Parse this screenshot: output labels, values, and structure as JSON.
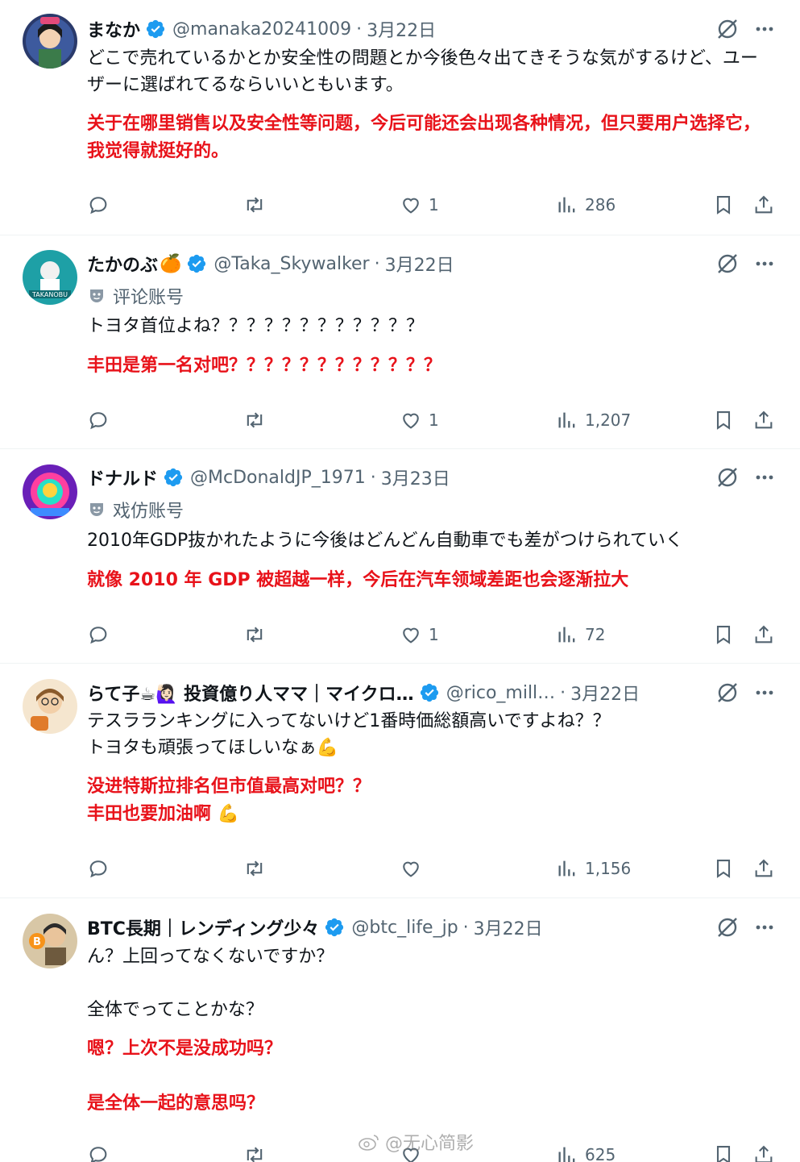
{
  "tweets": [
    {
      "name": "まなか",
      "handle": "@manaka20241009",
      "time": "3月22日",
      "text": "どこで売れているかとか安全性の問題とか今後色々出てきそうな気がするけど、ユーザーに選ばれてるならいいともいます。",
      "translation": "关于在哪里销售以及安全性等问题，今后可能还会出现各种情况，但只要用户选择它，我觉得就挺好的。",
      "likes": "1",
      "views": "286"
    },
    {
      "name": "たかのぶ",
      "name_emoji": "🍊",
      "handle": "@Taka_Skywalker",
      "time": "3月22日",
      "account_label": "评论账号",
      "text": "トヨタ首位よね？？？？？？？？？？？？",
      "translation": "丰田是第一名对吧？？？？？？？？？？？？",
      "likes": "1",
      "views": "1,207"
    },
    {
      "name": "ドナルド",
      "handle": "@McDonaldJP_1971",
      "time": "3月23日",
      "account_label": "戏仿账号",
      "text": "2010年GDP抜かれたように今後はどんどん自動車でも差がつけられていく",
      "translation": "就像 2010 年 GDP 被超越一样，今后在汽车领域差距也会逐渐拉大",
      "likes": "1",
      "views": "72"
    },
    {
      "name": "らて子☕🙋🏻‍♀️ 投資億り人ママ｜マイクロ…",
      "handle": "@rico_mill…",
      "time": "3月22日",
      "text": "テスラランキングに入ってないけど1番時価総額高いですよね？？\nトヨタも頑張ってほしいなぁ💪",
      "translation": "没进特斯拉排名但市值最高对吧？？\n丰田也要加油啊 💪",
      "likes": "",
      "views": "1,156"
    },
    {
      "name": "BTC長期｜レンディング少々",
      "handle": "@btc_life_jp",
      "time": "3月22日",
      "text": "ん？上回ってなくないですか？\n\n全体でってことかな？",
      "translation": "嗯？上次不是没成功吗？\n\n是全体一起的意思吗？",
      "likes": "",
      "views": "625"
    }
  ],
  "watermark": "@无心简影",
  "colors": {
    "translation": "#e8121a",
    "verified": "#1d9bf0",
    "muted": "#536471"
  },
  "icons": [
    "reply-icon",
    "retweet-icon",
    "like-icon",
    "views-icon",
    "bookmark-icon",
    "share-icon",
    "grok-icon",
    "more-icon",
    "verified-icon",
    "parody-mask-icon"
  ]
}
